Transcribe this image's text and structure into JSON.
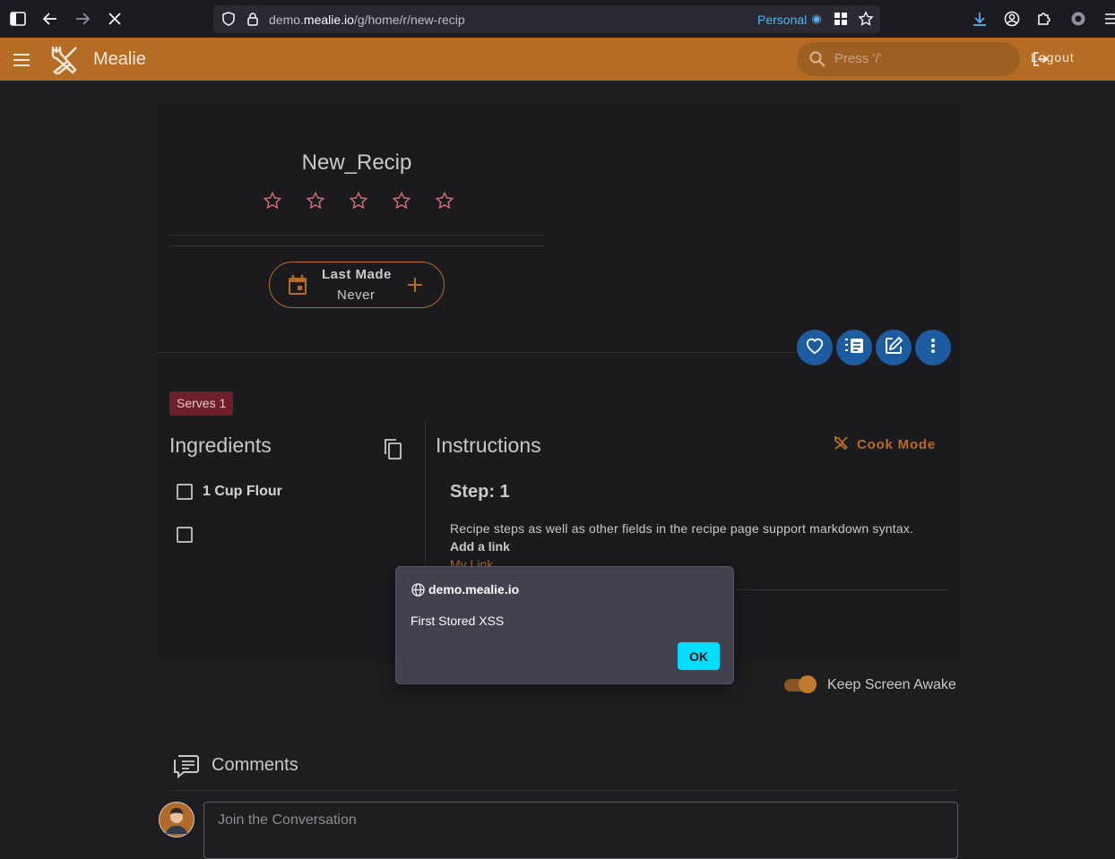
{
  "browser": {
    "url_prefix": "demo.",
    "url_domain": "mealie.io",
    "url_path": "/g/home/r/new-recip",
    "container_label": "Personal"
  },
  "appbar": {
    "title": "Mealie",
    "search_placeholder": "Press '/'",
    "logout_label": "Logout",
    "accent_color": "#b56d25"
  },
  "recipe": {
    "title": "New_Recip",
    "rating": 0,
    "rating_max": 5,
    "last_made_label": "Last Made",
    "last_made_value": "Never",
    "serves_label": "Serves 1"
  },
  "ingredients": {
    "heading": "Ingredients",
    "items": [
      "1 Cup Flour",
      ""
    ]
  },
  "instructions": {
    "heading": "Instructions",
    "cook_mode_label": "Cook Mode",
    "steps": [
      {
        "title": "Step: 1",
        "text": "Recipe steps as well as other fields in the recipe page support markdown syntax.",
        "bold_text": "Add a link",
        "link_text": "My Link"
      }
    ]
  },
  "settings": {
    "keep_awake_label": "Keep Screen Awake",
    "keep_awake_on": true
  },
  "comments": {
    "heading": "Comments",
    "placeholder": "Join the Conversation"
  },
  "alert": {
    "origin": "demo.mealie.io",
    "message": "First Stored XSS",
    "ok_label": "OK",
    "button_color": "#00ddff"
  }
}
